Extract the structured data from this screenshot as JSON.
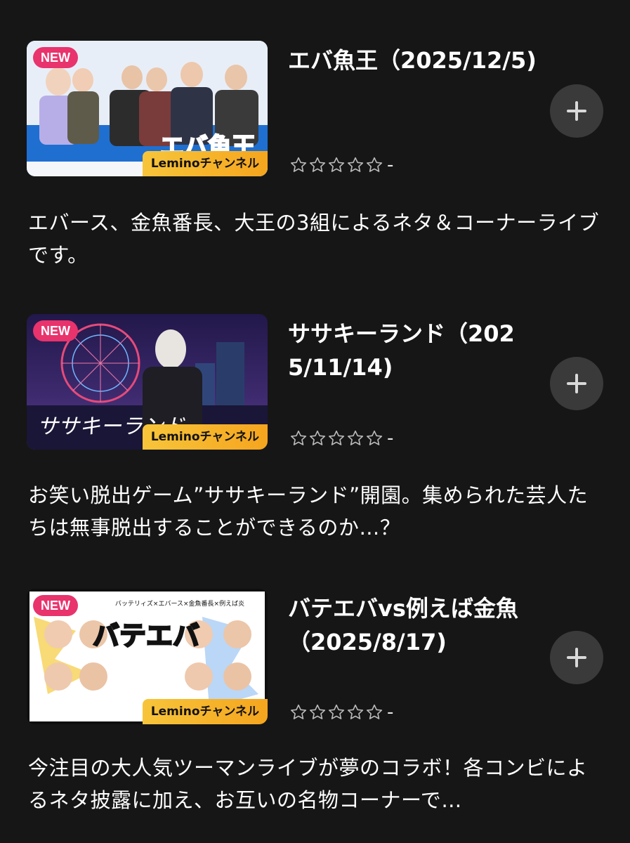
{
  "items": [
    {
      "badge_new": "NEW",
      "channel_badge": "Leminoチャンネル",
      "title": "エバ魚王（2025/12/5)",
      "rating_value": "-",
      "description": "エバース、金魚番長、大王の3組によるネタ＆コーナーライブです。",
      "thumbnail_text": "エバ魚王"
    },
    {
      "badge_new": "NEW",
      "channel_badge": "Leminoチャンネル",
      "title": "ササキーランド（2025/11/14)",
      "rating_value": "-",
      "description": "お笑い脱出ゲーム”ササキーランド”開園。集められた芸人たちは無事脱出することができるのか…？",
      "thumbnail_text": "ササキーランド"
    },
    {
      "badge_new": "NEW",
      "channel_badge": "Leminoチャンネル",
      "title": "バテエバvs例えば金魚（2025/8/17)",
      "rating_value": "-",
      "description": "今注目の大人気ツーマンライブが夢のコラボ！各コンビによるネタ披露に加え、お互いの名物コーナーで…",
      "thumbnail_text": "バテエバ",
      "thumbnail_subtext": "バッテリィズ×エバース×金魚番長×例えば炎"
    }
  ],
  "colors": {
    "background": "#161616",
    "badge_new": "#e8336d",
    "channel_badge": "#f5b52b",
    "add_button": "#3a3a3a"
  },
  "icons": [
    "plus-icon",
    "star-outline-icon"
  ]
}
